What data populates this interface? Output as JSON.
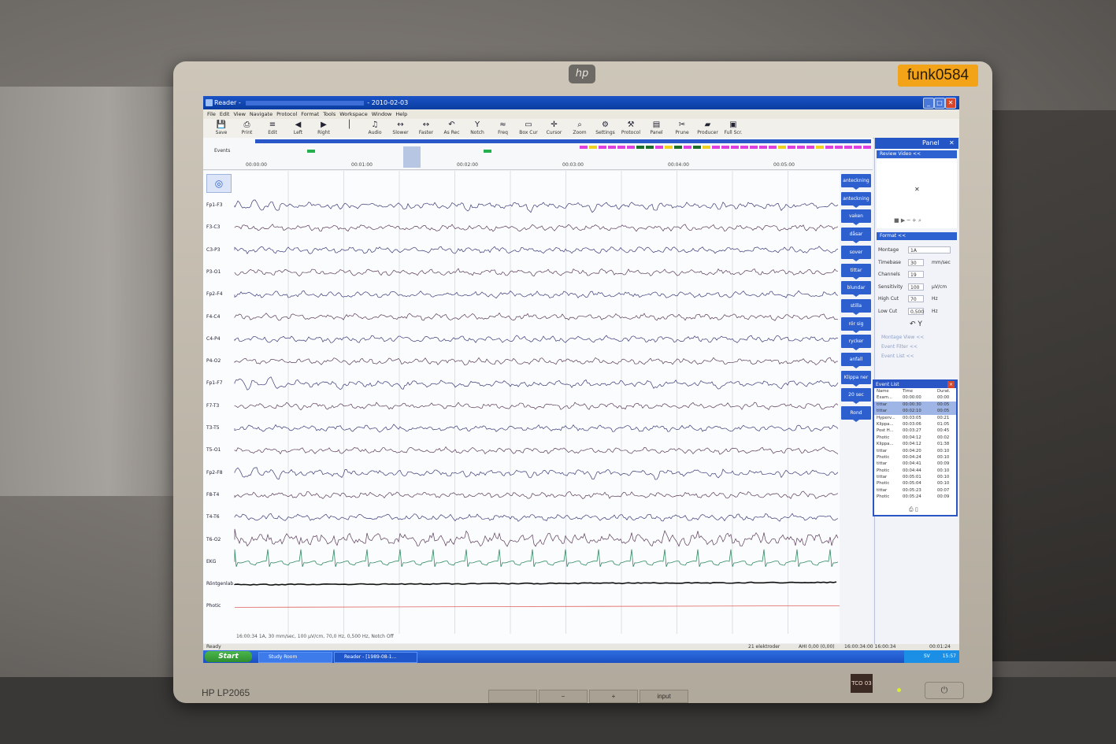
{
  "asset_tag": "funk0584",
  "monitor": {
    "brand": "hp",
    "model": "HP LP2065",
    "buttons": [
      "",
      "−",
      "+",
      "input"
    ],
    "power_symbol": "⏻",
    "badge": "TCO 03"
  },
  "window": {
    "title_app": "Reader - ",
    "title_date": "2010-02-03",
    "controls": [
      "_",
      "□",
      "✕"
    ]
  },
  "menu": [
    "File",
    "Edit",
    "View",
    "Navigate",
    "Protocol",
    "Format",
    "Tools",
    "Workspace",
    "Window",
    "Help"
  ],
  "toolbar": [
    {
      "label": "Save",
      "icon": "save-icon",
      "glyph": "💾"
    },
    {
      "label": "Print",
      "icon": "print-icon",
      "glyph": "⎙"
    },
    {
      "label": "Edit",
      "icon": "edit-icon",
      "glyph": "≡"
    },
    {
      "label": "Left",
      "icon": "left-icon",
      "glyph": "◀"
    },
    {
      "label": "Right",
      "icon": "right-icon",
      "glyph": "▶"
    },
    {
      "label": "",
      "icon": "marker-icon",
      "glyph": "│"
    },
    {
      "label": "Audio",
      "icon": "audio-icon",
      "glyph": "♫"
    },
    {
      "label": "Slower",
      "icon": "slower-icon",
      "glyph": "↔"
    },
    {
      "label": "Faster",
      "icon": "faster-icon",
      "glyph": "↔"
    },
    {
      "label": "As Rec",
      "icon": "as-rec-icon",
      "glyph": "↶"
    },
    {
      "label": "Notch",
      "icon": "notch-icon",
      "glyph": "Y"
    },
    {
      "label": "Freq",
      "icon": "freq-icon",
      "glyph": "≈"
    },
    {
      "label": "Box Cur",
      "icon": "box-cursor-icon",
      "glyph": "▭"
    },
    {
      "label": "Cursor",
      "icon": "cursor-icon",
      "glyph": "✛"
    },
    {
      "label": "Zoom",
      "icon": "zoom-icon",
      "glyph": "⌕"
    },
    {
      "label": "Settings",
      "icon": "settings-icon",
      "glyph": "⚙"
    },
    {
      "label": "Protocol",
      "icon": "protocol-icon",
      "glyph": "⚒"
    },
    {
      "label": "Panel",
      "icon": "panel-icon",
      "glyph": "▤"
    },
    {
      "label": "Prune",
      "icon": "prune-icon",
      "glyph": "✂"
    },
    {
      "label": "Producer",
      "icon": "producer-icon",
      "glyph": "▰"
    },
    {
      "label": "Full Scr.",
      "icon": "full-screen-icon",
      "glyph": "▣"
    }
  ],
  "events_bar": {
    "label": "Events",
    "timecodes": [
      "00:00:00",
      "00:01:00",
      "00:02:00",
      "00:03:00",
      "00:04:00",
      "00:05:00"
    ],
    "marker_colors": [
      "#22b14c",
      "#e040e0",
      "#f0d020",
      "#1f6f2a"
    ]
  },
  "channels": [
    "Fp1-F3",
    "F3-C3",
    "C3-P3",
    "P3-O1",
    "Fp2-F4",
    "F4-C4",
    "C4-P4",
    "P4-O2",
    "Fp1-F7",
    "F7-T3",
    "T3-T5",
    "T5-O1",
    "Fp2-F8",
    "F8-T4",
    "T4-T6",
    "T6-O2",
    "EKG",
    "Röntgenlab",
    "Photic"
  ],
  "trace_info": "16:00:34 1A, 30 mm/sec, 100 µV/cm, 70,0 Hz, 0,500 Hz, Notch Off",
  "annotation_buttons": [
    "anteckning",
    "anteckning",
    "vaken",
    "dåsar",
    "sover",
    "tittar",
    "blundar",
    "stilla",
    "rör sig",
    "rycker",
    "anfall",
    "Klippa ner",
    "20 sec",
    "Rond"
  ],
  "panel": {
    "title": "Panel",
    "review_video": "Review Video <<",
    "video_close": "✕",
    "format": "Format <<",
    "fields": [
      {
        "label": "Montage",
        "value": "1A",
        "unit": ""
      },
      {
        "label": "Timebase",
        "value": "30",
        "unit": "mm/sec"
      },
      {
        "label": "Channels",
        "value": "19",
        "unit": ""
      },
      {
        "label": "Sensitivity",
        "value": "100",
        "unit": "µV/cm"
      },
      {
        "label": "High Cut",
        "value": "70",
        "unit": "Hz"
      },
      {
        "label": "Low Cut",
        "value": "0,500",
        "unit": "Hz"
      }
    ],
    "links": [
      "Montage View <<",
      "Event Filter <<",
      "Event List <<"
    ]
  },
  "event_list": {
    "title": "Event List",
    "headers": [
      "Name",
      "Time",
      "Durat."
    ],
    "rows": [
      [
        "Exam...",
        "00:00:00",
        "00:00"
      ],
      [
        "tittar",
        "00:00:30",
        "00:05"
      ],
      [
        "tittar",
        "00:02:10",
        "00:05"
      ],
      [
        "Hyperv...",
        "00:03:05",
        "00:21"
      ],
      [
        "Klippa...",
        "00:03:06",
        "01:05"
      ],
      [
        "Post H...",
        "00:03:27",
        "00:45"
      ],
      [
        "Photic",
        "00:04:12",
        "00:02"
      ],
      [
        "Klippa...",
        "00:04:12",
        "01:38"
      ],
      [
        "tittar",
        "00:04:20",
        "00:10"
      ],
      [
        "Photic",
        "00:04:24",
        "00:10"
      ],
      [
        "tittar",
        "00:04:41",
        "00:09"
      ],
      [
        "Photic",
        "00:04:44",
        "00:10"
      ],
      [
        "tittar",
        "00:05:01",
        "00:10"
      ],
      [
        "Photic",
        "00:05:04",
        "00:10"
      ],
      [
        "tittar",
        "00:05:23",
        "00:07"
      ],
      [
        "Photic",
        "00:05:24",
        "00:09"
      ]
    ]
  },
  "status": {
    "left": "Ready",
    "electrodes": "21 elektroder",
    "ahi": "AHI 0,00 (0,00)",
    "times": "16:00:34:00  16:00:34",
    "elapsed": "00:01:24"
  },
  "taskbar": {
    "start": "Start",
    "tasks": [
      "Study Room",
      "Reader - [1989-08-1..."
    ],
    "lang": "SV",
    "clock": "15:57"
  }
}
